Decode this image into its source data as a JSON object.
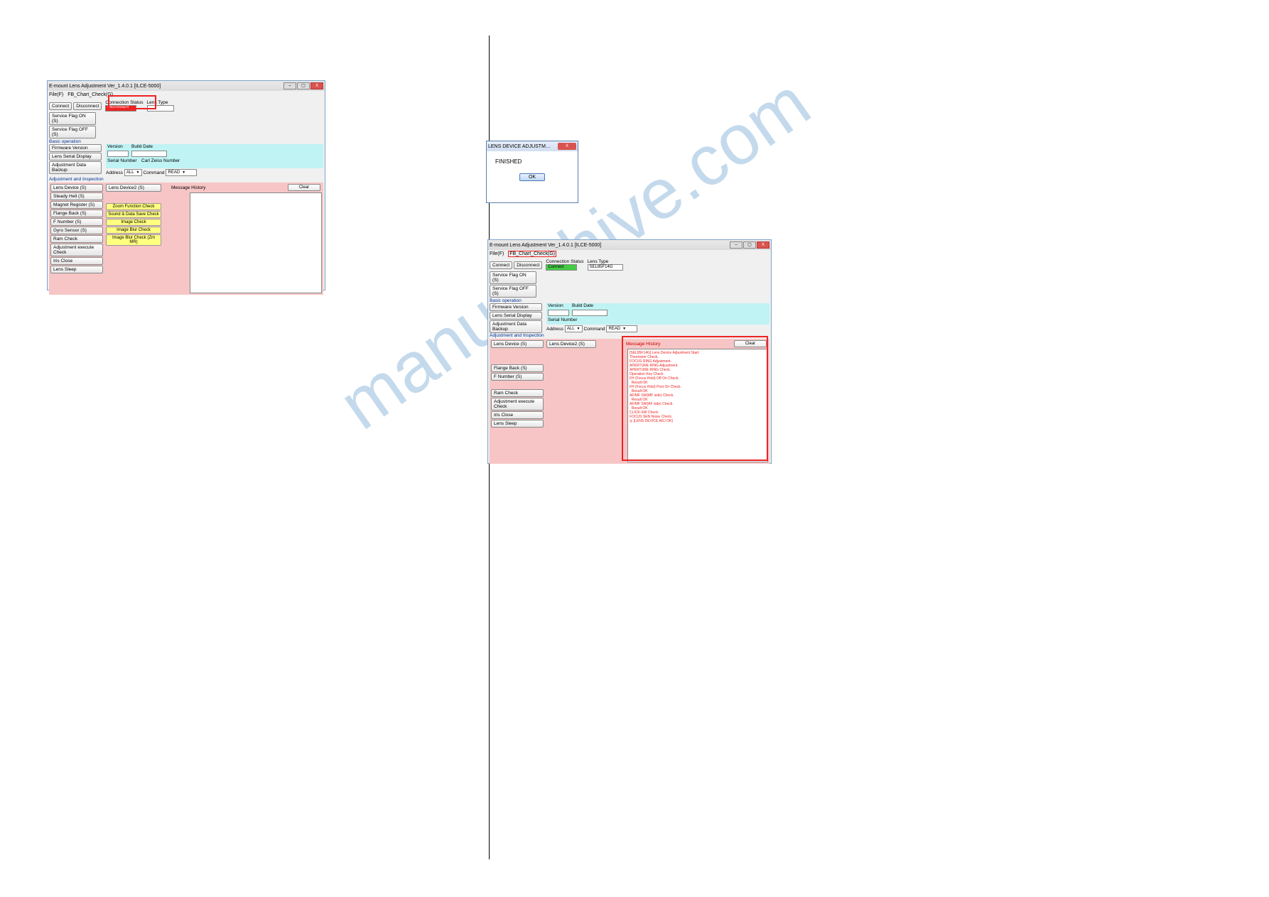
{
  "divider": true,
  "watermark": "manualshive.com",
  "app1": {
    "title": "E-mount Lens Adjustment  Ver_1.4.0.1 [ILCE-5000]",
    "win_min": "–",
    "win_max": "▢",
    "win_close": "X",
    "menu_file": "File(F)",
    "menu_fb": "FB_Chart_Check(G)",
    "btn_connect": "Connect",
    "btn_disconnect": "Disconnect",
    "lbl_conn_status": "Connection Status",
    "status_text": "Disconnect",
    "lbl_lens_type": "Lens Type",
    "lens_type": "",
    "btn_svc_on": "Service Flag ON (S)",
    "btn_svc_off": "Service Flag OFF (S)",
    "grp_basic": "Basic operation",
    "btn_firmware": "Firmware Version",
    "lbl_version": "Version",
    "lbl_build": "Build Date",
    "btn_serial": "Lens Serial Display",
    "lbl_serial": "Serial Number",
    "lbl_czn": "Carl Zeiss Number",
    "btn_adj_backup": "Adjustment Data Backup",
    "lbl_addr": "Address",
    "addr_val": "ALL",
    "lbl_cmd": "Command",
    "cmd_val": "READ",
    "grp_adj": "Adjustment and Inspection",
    "col_left": [
      "Lens Device (S)",
      "Steady Hell (S)",
      "Magnet Register (S)",
      "Flange Back (S)",
      "F Number (S)",
      "Gyro Sensor (S)",
      "Ram Check",
      "Adjustment execute Check",
      "Iris Close",
      "Lens Sleep"
    ],
    "col_mid_btn": "Lens Device2 (S)",
    "col_mid_yellow": [
      "Zoom Function Check",
      "Sound & Data Save Check",
      "Image Check",
      "Image Blur Check",
      "Image Blur Check (Zm MR)"
    ],
    "msg_label": "Message History",
    "btn_clear": "Clear"
  },
  "dialog": {
    "title": "LENS DEVICE ADJUSTM…",
    "close": "X",
    "body": "FINISHED",
    "ok": "OK"
  },
  "app2": {
    "title": "E-mount Lens Adjustment  Ver_1.4.0.1 [ILCE-5000]",
    "win_min": "–",
    "win_max": "▢",
    "win_close": "X",
    "menu_file": "File(F)",
    "menu_fb": "FB_Chart_Check(G)",
    "btn_connect": "Connect",
    "btn_disconnect": "Disconnect",
    "lbl_conn_status": "Connection Status",
    "status_text": "Connect",
    "lbl_lens_type": "Lens Type",
    "lens_type": "SEL85F14G",
    "btn_svc_on": "Service Flag ON (S)",
    "btn_svc_off": "Service Flag OFF (S)",
    "grp_basic": "Basic operation",
    "btn_firmware": "Firmware Version",
    "lbl_version": "Version",
    "lbl_build": "Build Date",
    "btn_serial": "Lens Serial Display",
    "lbl_serial": "Serial Number",
    "btn_adj_backup": "Adjustment Data Backup",
    "lbl_addr": "Address",
    "addr_val": "ALL",
    "lbl_cmd": "Command",
    "cmd_val": "READ",
    "grp_adj": "Adjustment and Inspection",
    "col_left": [
      "Lens Device (S)",
      "",
      "",
      "Flange Back (S)",
      "F Number (S)",
      "",
      "Ram Check",
      "Adjustment execute Check",
      "Iris Close",
      "Lens Sleep"
    ],
    "col_mid_btn": "Lens Device2 (S)",
    "msg_label": "Message History",
    "btn_clear": "Clear",
    "msg_lines": [
      "[SEL85F14G] Lens Device Adjustment Start.",
      "Thermistor Check.",
      "FOCUS RING Adjustment.",
      "APERTURE RING Adjustment.",
      "APERTURE RING Check.",
      "Operation Key Check.",
      "FH (Focus Hold) Off On Check.",
      "  Result:OK",
      "FH (Focus Hold) Post On Check.",
      "  Result:OK",
      "AF/MF SW(MF side) Check.",
      "  Result:OK",
      "AF/MF SW(AF side) Check.",
      "  Result:OK",
      "CLICK-SW Check.",
      "FOCUS SEN Noise Check.",
      "◎ [LENS DEVICE ADJ OK]"
    ]
  }
}
